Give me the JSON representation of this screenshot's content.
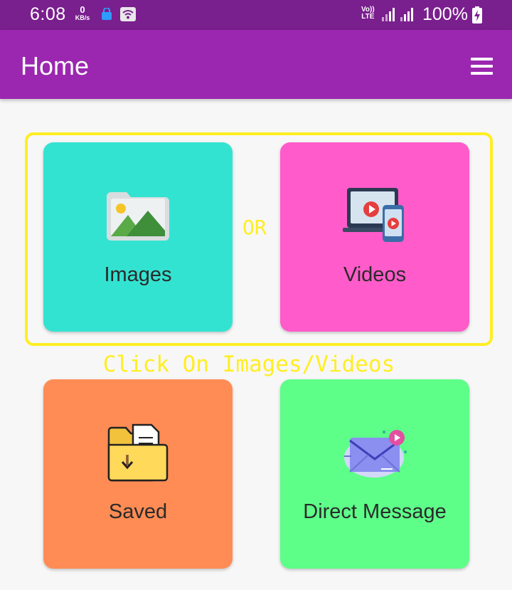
{
  "status_bar": {
    "time": "6:08",
    "speed_value": "0",
    "speed_unit": "KB/s",
    "volte_line1": "Vo))",
    "volte_line2": "LTE",
    "battery": "100%"
  },
  "app_bar": {
    "title": "Home",
    "menu_icon": "hamburger-menu-icon"
  },
  "colors": {
    "status_bar": "#7a1f8e",
    "app_bar": "#9b27b0",
    "images_card": "#33e3d1",
    "videos_card": "#ff5bca",
    "saved_card": "#ff8c54",
    "direct_card": "#5dff89",
    "highlight": "#ffee22"
  },
  "cards": {
    "images": {
      "label": "Images",
      "icon": "image-gallery-icon"
    },
    "videos": {
      "label": "Videos",
      "icon": "video-devices-icon"
    },
    "saved": {
      "label": "Saved",
      "icon": "download-folder-icon"
    },
    "direct": {
      "label": "Direct Message",
      "icon": "message-envelope-icon"
    }
  },
  "or_text": "OR",
  "hint": "Click On Images/Videos"
}
